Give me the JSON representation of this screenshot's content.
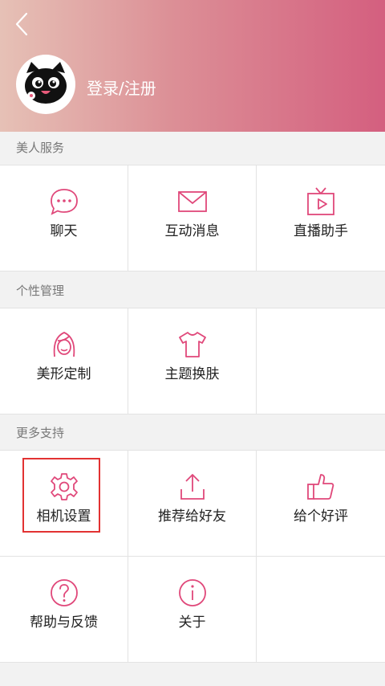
{
  "header": {
    "login_label": "登录/注册",
    "gradient_colors": [
      "#e6c1b6",
      "#dc8f96",
      "#d45f7f"
    ]
  },
  "icon_color": "#e0487a",
  "sections": [
    {
      "title": "美人服务",
      "items": [
        {
          "label": "聊天",
          "icon": "chat-bubble-icon"
        },
        {
          "label": "互动消息",
          "icon": "envelope-icon"
        },
        {
          "label": "直播助手",
          "icon": "tv-play-icon"
        }
      ]
    },
    {
      "title": "个性管理",
      "items": [
        {
          "label": "美形定制",
          "icon": "face-icon"
        },
        {
          "label": "主题换肤",
          "icon": "tshirt-icon"
        }
      ]
    },
    {
      "title": "更多支持",
      "items": [
        {
          "label": "相机设置",
          "icon": "gear-icon"
        },
        {
          "label": "推荐给好友",
          "icon": "share-upload-icon"
        },
        {
          "label": "给个好评",
          "icon": "thumbs-up-icon"
        },
        {
          "label": "帮助与反馈",
          "icon": "help-question-icon"
        },
        {
          "label": "关于",
          "icon": "info-icon"
        }
      ]
    }
  ],
  "highlight_color": "#e23232"
}
